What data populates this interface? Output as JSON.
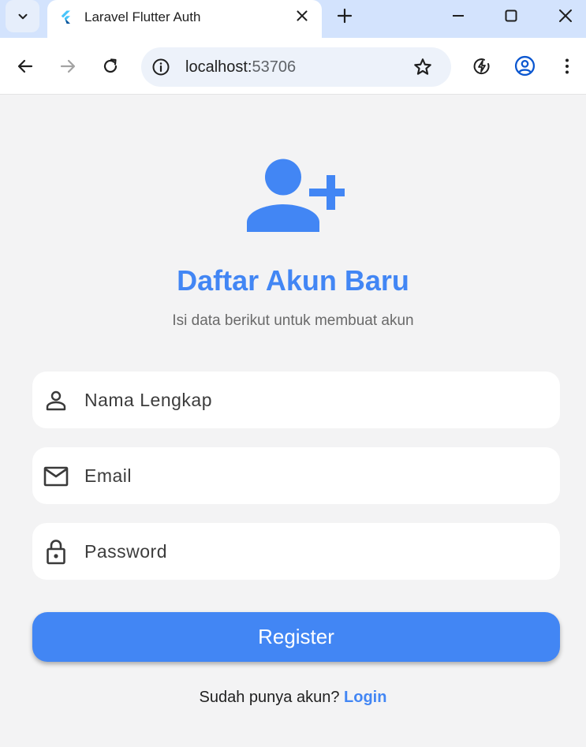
{
  "browser": {
    "tab_title": "Laravel Flutter Auth",
    "url_host": "localhost:",
    "url_port": "53706"
  },
  "icons": {
    "tab_search": "chevron-down-icon",
    "favicon": "flutter-logo-icon",
    "tab_close": "close-icon",
    "new_tab": "plus-icon",
    "minimize": "minimize-icon",
    "maximize": "maximize-icon",
    "close_window": "close-icon",
    "back": "arrow-left-icon",
    "forward": "arrow-right-icon",
    "reload": "reload-icon",
    "site_info": "info-icon",
    "bookmark": "star-icon",
    "performance": "lightning-icon",
    "profile": "account-circle-icon",
    "menu": "more-vert-icon",
    "hero": "person-add-icon",
    "name_field": "person-icon",
    "email_field": "mail-icon",
    "password_field": "lock-icon"
  },
  "page": {
    "title": "Daftar Akun Baru",
    "subtitle": "Isi data berikut untuk membuat akun",
    "name_placeholder": "Nama Lengkap",
    "email_placeholder": "Email",
    "password_placeholder": "Password",
    "register_label": "Register",
    "footer_text": "Sudah punya akun? ",
    "login_label": "Login"
  },
  "colors": {
    "accent": "#4286f4",
    "tabbar_bg": "#d3e3fd",
    "page_bg": "#f3f3f4",
    "field_bg": "#ffffff"
  }
}
